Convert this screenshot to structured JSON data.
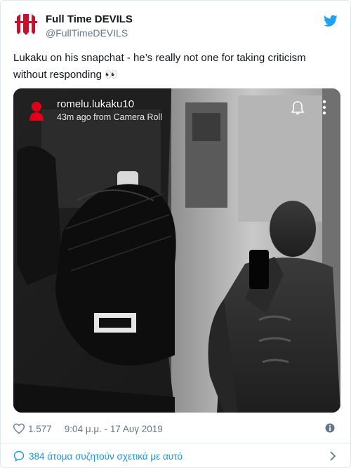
{
  "author": {
    "name": "Full Time DEVILS",
    "handle": "@FullTimeDEVILS",
    "avatar_icon": "devil-trident-logo-icon"
  },
  "tweet": {
    "text": "Lukaku on his snapchat - he’s really not one for taking criticism without responding 👀"
  },
  "snapchat_overlay": {
    "username": "romelu.lukaku10",
    "timestamp": "43m ago from Camera Roll"
  },
  "meta": {
    "likes": "1.577",
    "datetime": "9:04 μ.μ. - 17 Αυγ 2019"
  },
  "footer": {
    "conversation_text": "384 άτομα συζητούν σχετικά με αυτό"
  },
  "colors": {
    "brand_red": "#c8102e",
    "twitter_blue": "#1da1f2",
    "link_blue": "#1b95e0",
    "meta_gray": "#657786"
  }
}
